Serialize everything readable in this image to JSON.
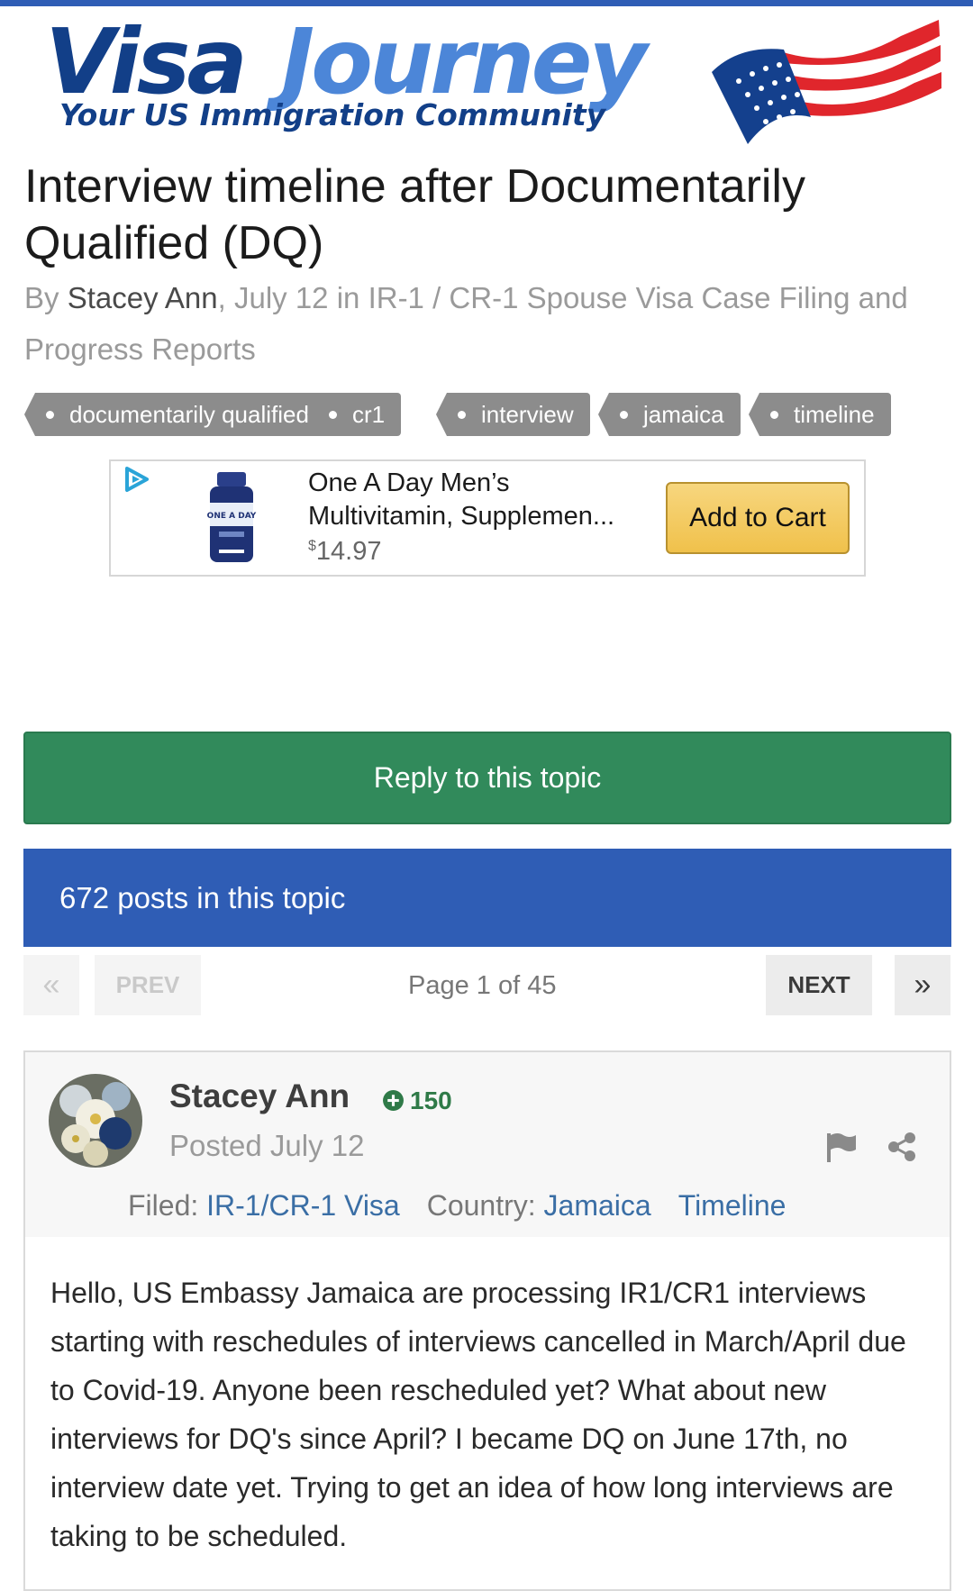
{
  "brand": {
    "name_part1": "Visa",
    "name_part2": "Journey",
    "tagline": "Your US Immigration Community"
  },
  "topic": {
    "title": "Interview timeline after Documentarily Qualified (DQ)",
    "by_prefix": "By ",
    "author": "Stacey Ann",
    "date_text": ", July 12 in ",
    "forum": "IR-1 / CR-1 Spouse Visa Case Filing and Progress Reports",
    "tags": [
      "documentarily qualified",
      "cr1",
      "interview",
      "jamaica",
      "timeline"
    ]
  },
  "ad": {
    "product_name": "One A Day Men’s Multivitamin, Supplemen...",
    "currency": "$",
    "price": "14.97",
    "cta_label": "Add to Cart"
  },
  "actions": {
    "reply_label": "Reply to this topic"
  },
  "posts_bar": {
    "count_text": "672 posts in this topic"
  },
  "pagination": {
    "first_label": "«",
    "prev_label": "PREV",
    "page_label": "Page 1 of 45",
    "next_label": "NEXT",
    "last_label": "»"
  },
  "post": {
    "author": "Stacey Ann",
    "reputation": "150",
    "posted": "Posted July 12",
    "filed_label": "Filed:",
    "filed_value": "IR-1/CR-1 Visa",
    "country_label": "Country:",
    "country_value": "Jamaica",
    "timeline_label": "Timeline",
    "body": "Hello, US Embassy Jamaica are processing IR1/CR1 interviews starting with reschedules of interviews cancelled in March/April due to Covid-19. Anyone been rescheduled yet? What about new interviews for DQ's since April? I became DQ on June 17th, no interview date yet. Trying to get an idea of how long interviews are taking to be scheduled."
  },
  "colors": {
    "brand_dark": "#123f88",
    "brand_light": "#4c86d8",
    "reply_green": "#318a5b",
    "posts_blue": "#2f5db5",
    "tag_gray": "#8c8c8c",
    "link_blue": "#3a6ea5"
  }
}
